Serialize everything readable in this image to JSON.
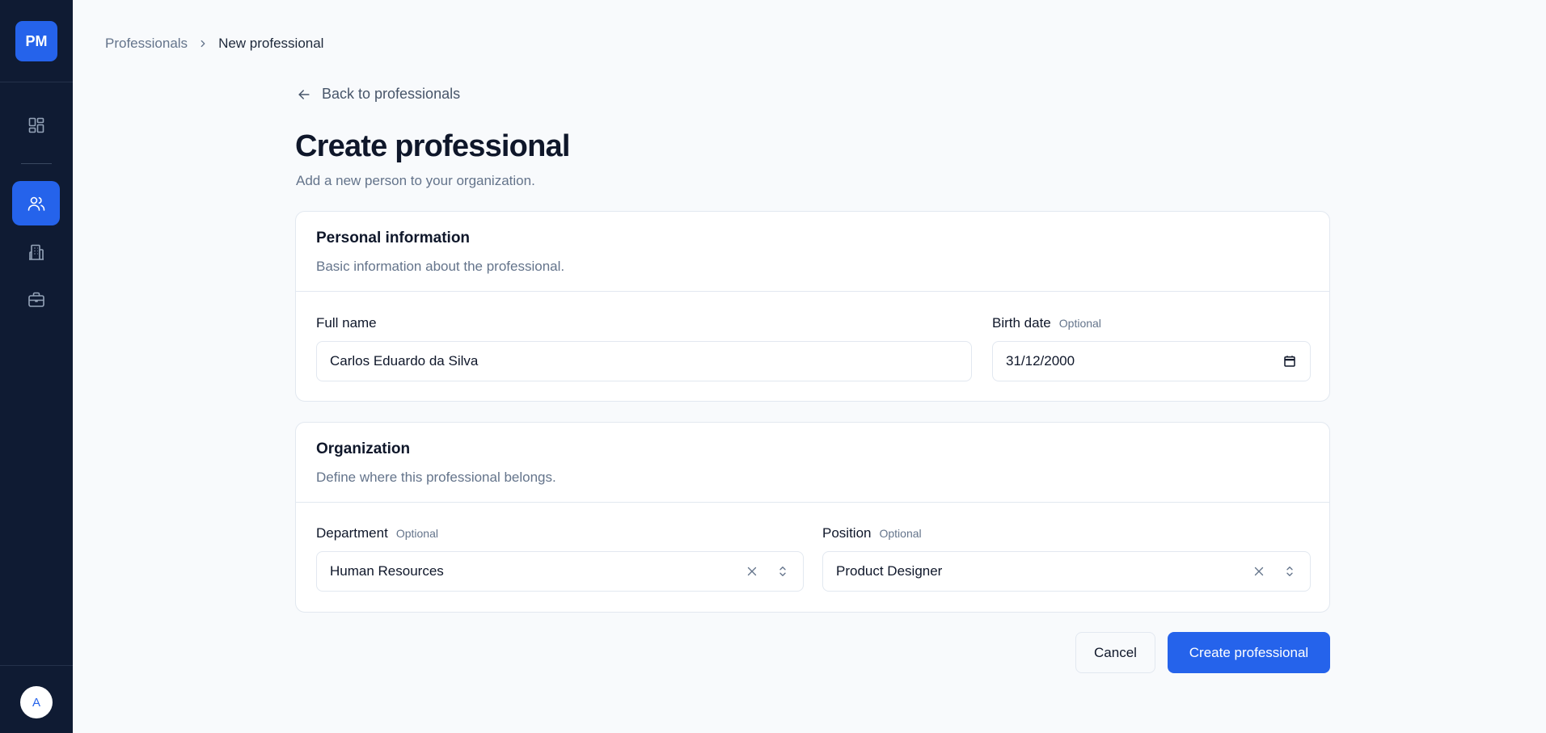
{
  "sidebar": {
    "logo_text": "PM",
    "nav": [
      {
        "name": "dashboard",
        "icon": "dashboard-icon",
        "active": false
      },
      {
        "name": "professionals",
        "icon": "users-icon",
        "active": true
      },
      {
        "name": "departments",
        "icon": "building-icon",
        "active": false
      },
      {
        "name": "positions",
        "icon": "briefcase-icon",
        "active": false
      }
    ],
    "avatar_text": "A"
  },
  "breadcrumb": {
    "parent": "Professionals",
    "current": "New professional"
  },
  "back_link": "Back to professionals",
  "page": {
    "title": "Create professional",
    "subtitle": "Add a new person to your organization."
  },
  "personal": {
    "title": "Personal information",
    "description": "Basic information about the professional.",
    "full_name_label": "Full name",
    "full_name_value": "Carlos Eduardo da Silva",
    "birth_date_label": "Birth date",
    "birth_date_optional": "Optional",
    "birth_date_value": "31/12/2000"
  },
  "organization": {
    "title": "Organization",
    "description": "Define where this professional belongs.",
    "department_label": "Department",
    "department_optional": "Optional",
    "department_value": "Human Resources",
    "position_label": "Position",
    "position_optional": "Optional",
    "position_value": "Product Designer"
  },
  "actions": {
    "cancel": "Cancel",
    "submit": "Create professional"
  },
  "colors": {
    "sidebar_bg": "#0f1b33",
    "accent": "#2563eb",
    "page_bg": "#f8fafc"
  }
}
